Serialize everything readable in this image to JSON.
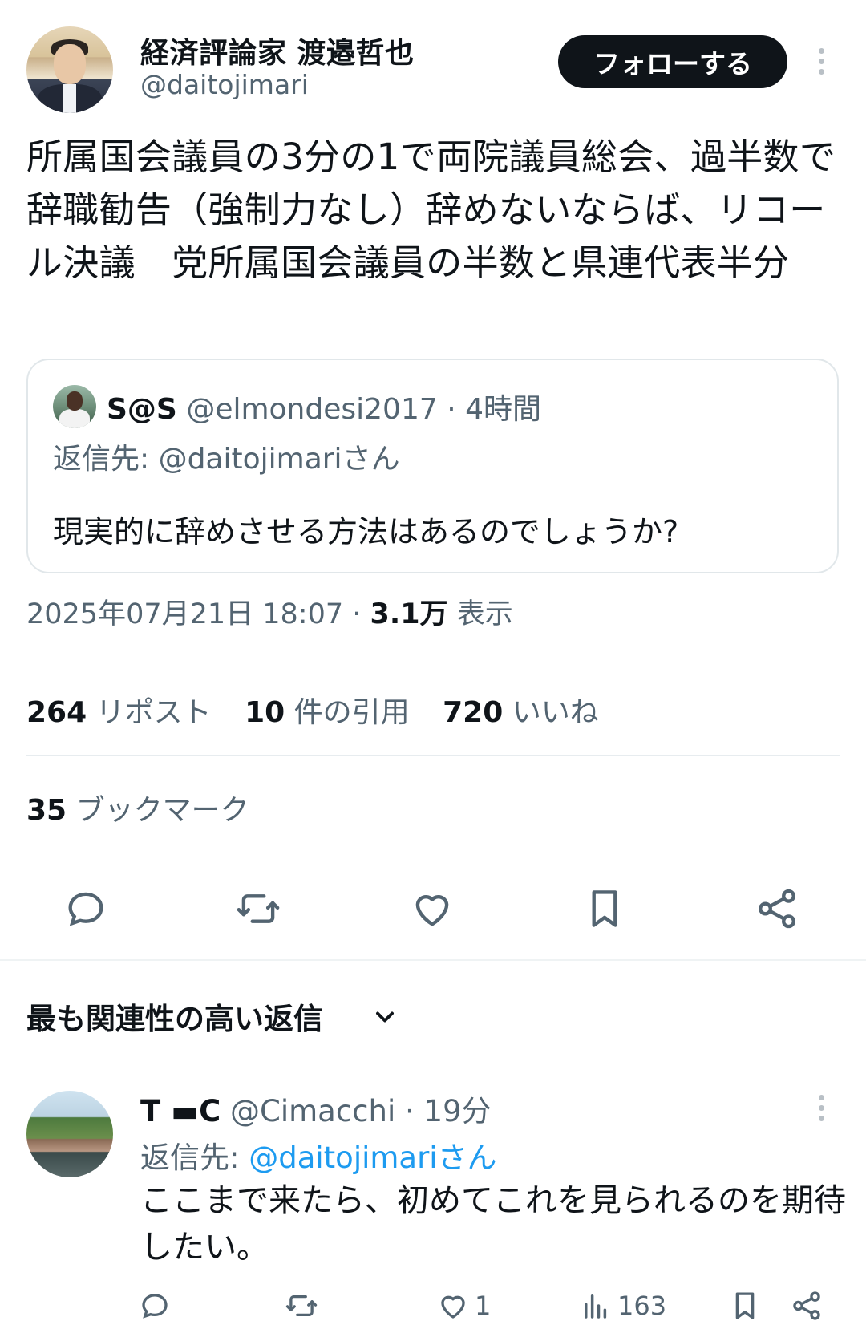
{
  "author": {
    "name": "経済評論家 渡邉哲也",
    "handle": "@daitojimari",
    "follow_label": "フォローする"
  },
  "tweet": {
    "text": "所属国会議員の3分の1で両院議員総会、過半数で辞職勧告（強制力なし）辞めないならば、リコール決議　党所属国会議員の半数と県連代表半分",
    "timestamp": "2025年07月21日 18:07",
    "views_count": "3.1万",
    "views_label": "表示"
  },
  "quote": {
    "name": "S@S",
    "handle": "@elmondesi2017",
    "time": "4時間",
    "reply_to": "返信先: @daitojimariさん",
    "text": "現実的に辞めさせる方法はあるのでしょうか?"
  },
  "stats": {
    "reposts_num": "264",
    "reposts_label": "リポスト",
    "quotes_num": "10",
    "quotes_label": "件の引用",
    "likes_num": "720",
    "likes_label": "いいね",
    "bookmarks_num": "35",
    "bookmarks_label": "ブックマーク"
  },
  "actions": [
    "reply-icon",
    "repost-icon",
    "like-icon",
    "bookmark-icon",
    "share-icon"
  ],
  "replies_section": {
    "title": "最も関連性の高い返信"
  },
  "reply": {
    "name": "T ▬C",
    "handle": "@Cimacchi",
    "time": "19分",
    "reply_prefix": "返信先: ",
    "reply_to": "@daitojimariさん",
    "text": "ここまで来たら、初めてこれを見られるのを期待したい。",
    "likes": "1",
    "views": "163"
  },
  "colors": {
    "text": "#0f1419",
    "secondary": "#536471",
    "link": "#1d9bf0",
    "divider": "#e7ecef"
  }
}
